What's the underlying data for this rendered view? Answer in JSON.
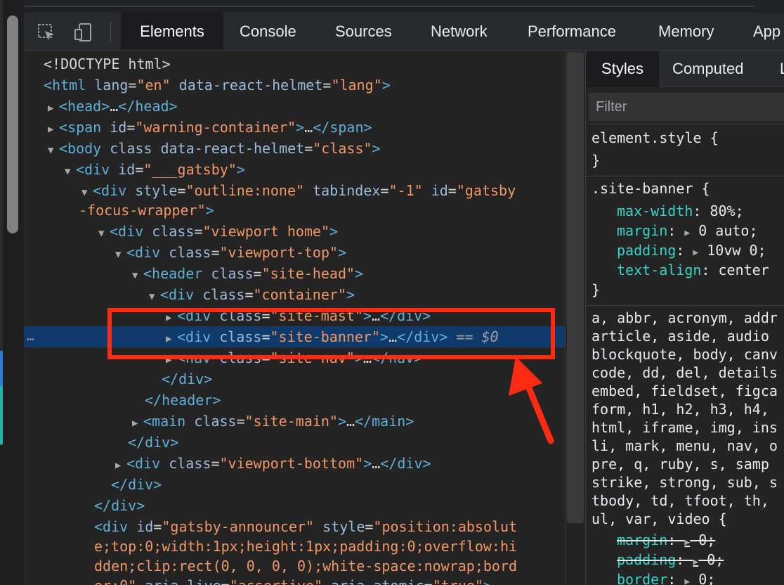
{
  "toolbar": {
    "tabs": [
      "Elements",
      "Console",
      "Sources",
      "Network",
      "Performance",
      "Memory",
      "App"
    ],
    "active_tab": "Elements",
    "icons": [
      "inspect-element-icon",
      "device-toggle-icon"
    ]
  },
  "dom": {
    "lines": [
      {
        "tri": "",
        "tag_open": "<!DOCTYPE html>"
      },
      {
        "text": "html"
      },
      {
        "text": "head"
      },
      {
        "text": "span"
      },
      {
        "text": "body"
      }
    ],
    "selected_suffix": "== $0",
    "gutter_dots": "…"
  },
  "styles": {
    "tabs": [
      "Styles",
      "Computed",
      "L"
    ],
    "active_tab": "Styles",
    "filter_placeholder": "Filter",
    "element_style_selector": "element.style {",
    "close_brace": "}",
    "rule1_selector": ".site-banner {",
    "rule1_props": [
      {
        "name": "max-width",
        "value": "80%;"
      },
      {
        "name": "margin",
        "value": "0 auto;"
      },
      {
        "name": "padding",
        "value": "10vw 0;"
      },
      {
        "name": "text-align",
        "value": "center"
      }
    ],
    "rule2_selector_lines": [
      "a, abbr, acronym, addr",
      "article, aside, audio",
      "blockquote, body, canv",
      "code, dd, del, details",
      "embed, fieldset, figca",
      "form, h1, h2, h3, h4,",
      "html, iframe, img, ins",
      "li, mark, menu, nav, o",
      "pre, q, ruby, s, samp",
      "strike, strong, sub, s",
      "tbody, td, tfoot, th,",
      "ul, var, video {"
    ],
    "rule2_props": [
      {
        "name": "margin",
        "value": "0;"
      },
      {
        "name": "padding",
        "value": "0;"
      },
      {
        "name": "border",
        "value": "0;"
      }
    ]
  },
  "colors": {
    "annotation": "#ff2a12",
    "selection": "#0f3a6a",
    "tag": "#5db0d7",
    "attr_value": "#f29766",
    "css_prop": "#35d4c7"
  }
}
